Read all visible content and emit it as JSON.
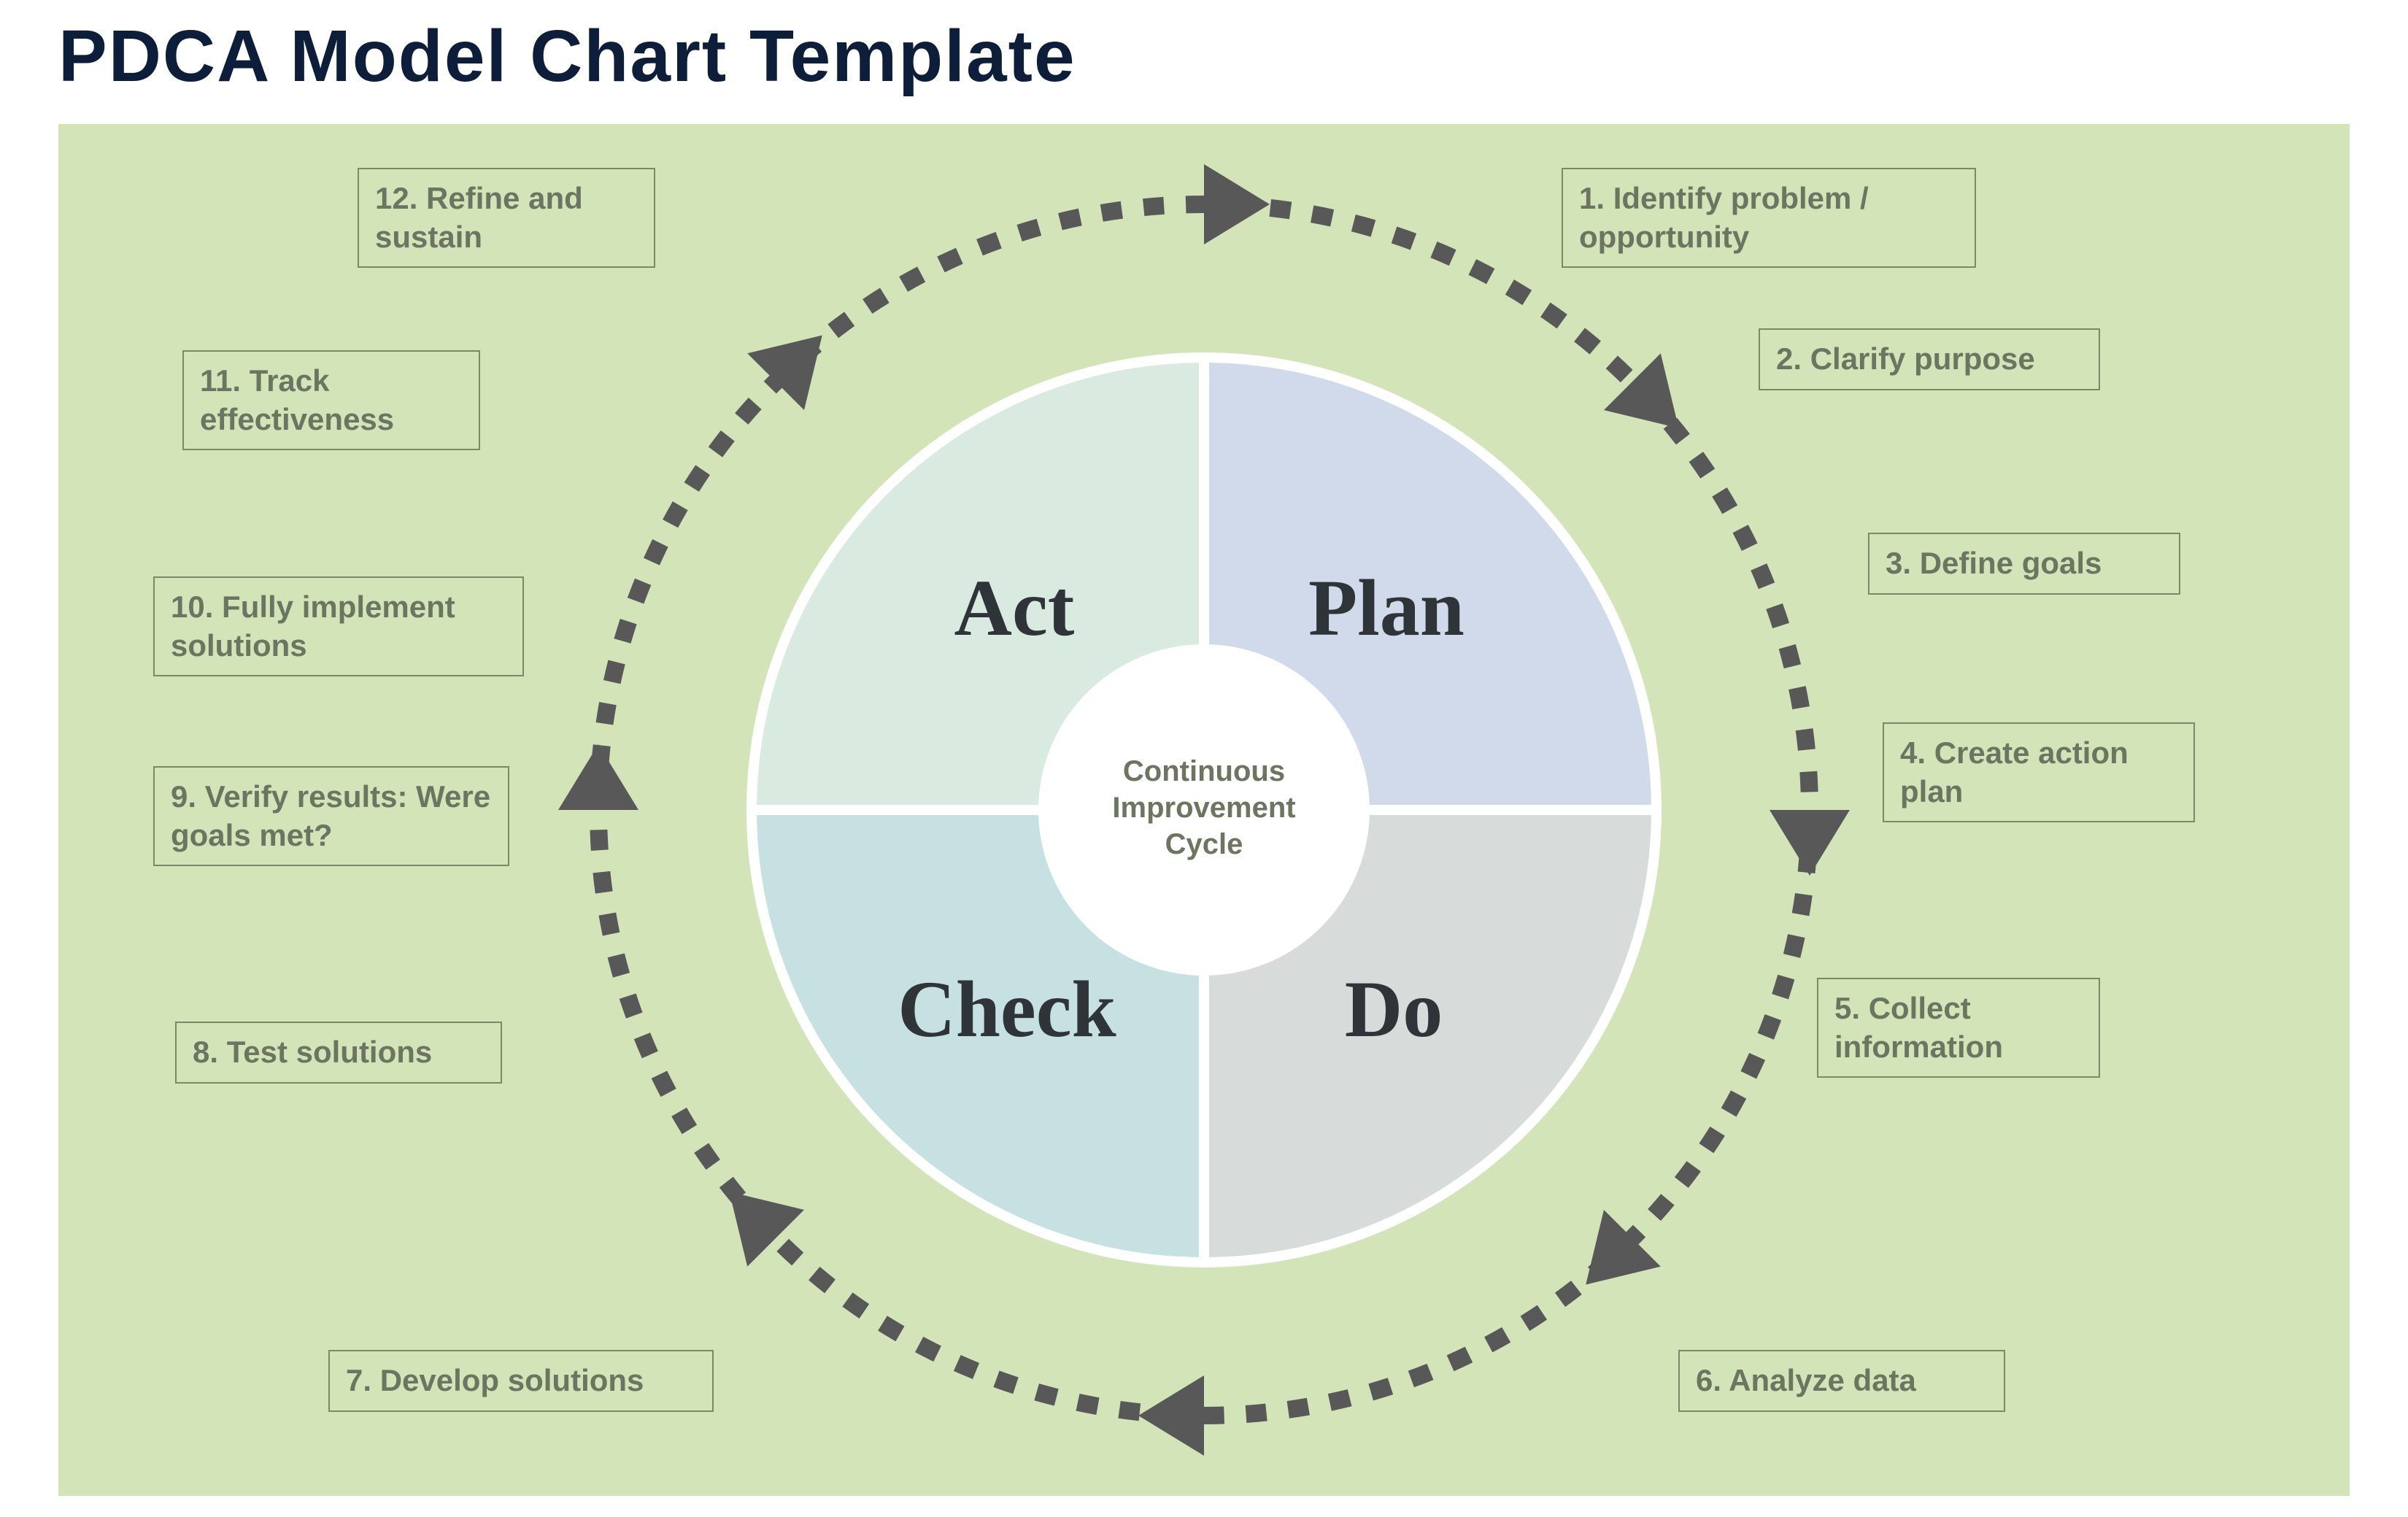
{
  "title": "PDCA Model Chart Template",
  "center": {
    "line1": "Continuous",
    "line2": "Improvement",
    "line3": "Cycle"
  },
  "quadrants": {
    "plan": {
      "label": "Plan",
      "fill": "#d1daea"
    },
    "do": {
      "label": "Do",
      "fill": "#d7dbd9"
    },
    "check": {
      "label": "Check",
      "fill": "#c7e0e2"
    },
    "act": {
      "label": "Act",
      "fill": "#d9eae0"
    }
  },
  "steps": [
    {
      "n": 1,
      "text": "1. Identify problem / opportunity"
    },
    {
      "n": 2,
      "text": "2. Clarify purpose"
    },
    {
      "n": 3,
      "text": "3. Define goals"
    },
    {
      "n": 4,
      "text": "4. Create action plan"
    },
    {
      "n": 5,
      "text": "5. Collect information"
    },
    {
      "n": 6,
      "text": "6. Analyze data"
    },
    {
      "n": 7,
      "text": "7. Develop solutions"
    },
    {
      "n": 8,
      "text": "8. Test solutions"
    },
    {
      "n": 9,
      "text": "9. Verify results: Were goals met?"
    },
    {
      "n": 10,
      "text": "10. Fully implement solutions"
    },
    {
      "n": 11,
      "text": "11. Track effectiveness"
    },
    {
      "n": 12,
      "text": "12. Refine and sustain"
    }
  ],
  "colors": {
    "arrow": "#585858",
    "dash": "#585858",
    "quadStroke": "#ffffff",
    "canvas": "#d3e4b8"
  }
}
